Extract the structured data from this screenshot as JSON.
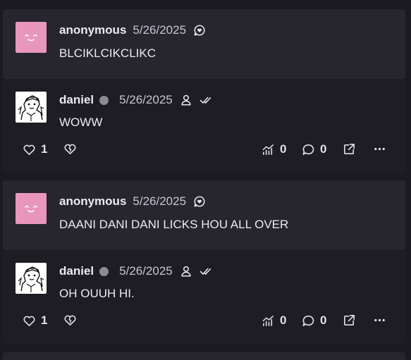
{
  "colors": {
    "background": "#1b1a20",
    "question_card": "#27252e",
    "answer_card": "#1e1d23",
    "avatar_pink": "#e996be",
    "status_dot": "#8d8a93"
  },
  "posts": [
    {
      "question": {
        "author": "anonymous",
        "date": "5/26/2025",
        "icon": "anonymous-question-icon",
        "text": "BLCIKLCIKCLIKC"
      },
      "answer": {
        "author": "daniel",
        "date": "5/26/2025",
        "icons": [
          "user-icon",
          "double-check-icon"
        ],
        "text": "WOWW",
        "likes": "1",
        "views": "0",
        "comments": "0"
      }
    },
    {
      "question": {
        "author": "anonymous",
        "date": "5/26/2025",
        "icon": "anonymous-question-icon",
        "text": "DAANI DANI DANI LICKS HOU ALL OVER"
      },
      "answer": {
        "author": "daniel",
        "date": "5/26/2025",
        "icons": [
          "user-icon",
          "double-check-icon"
        ],
        "text": "OH OUUH HI.",
        "likes": "1",
        "views": "0",
        "comments": "0"
      }
    }
  ]
}
